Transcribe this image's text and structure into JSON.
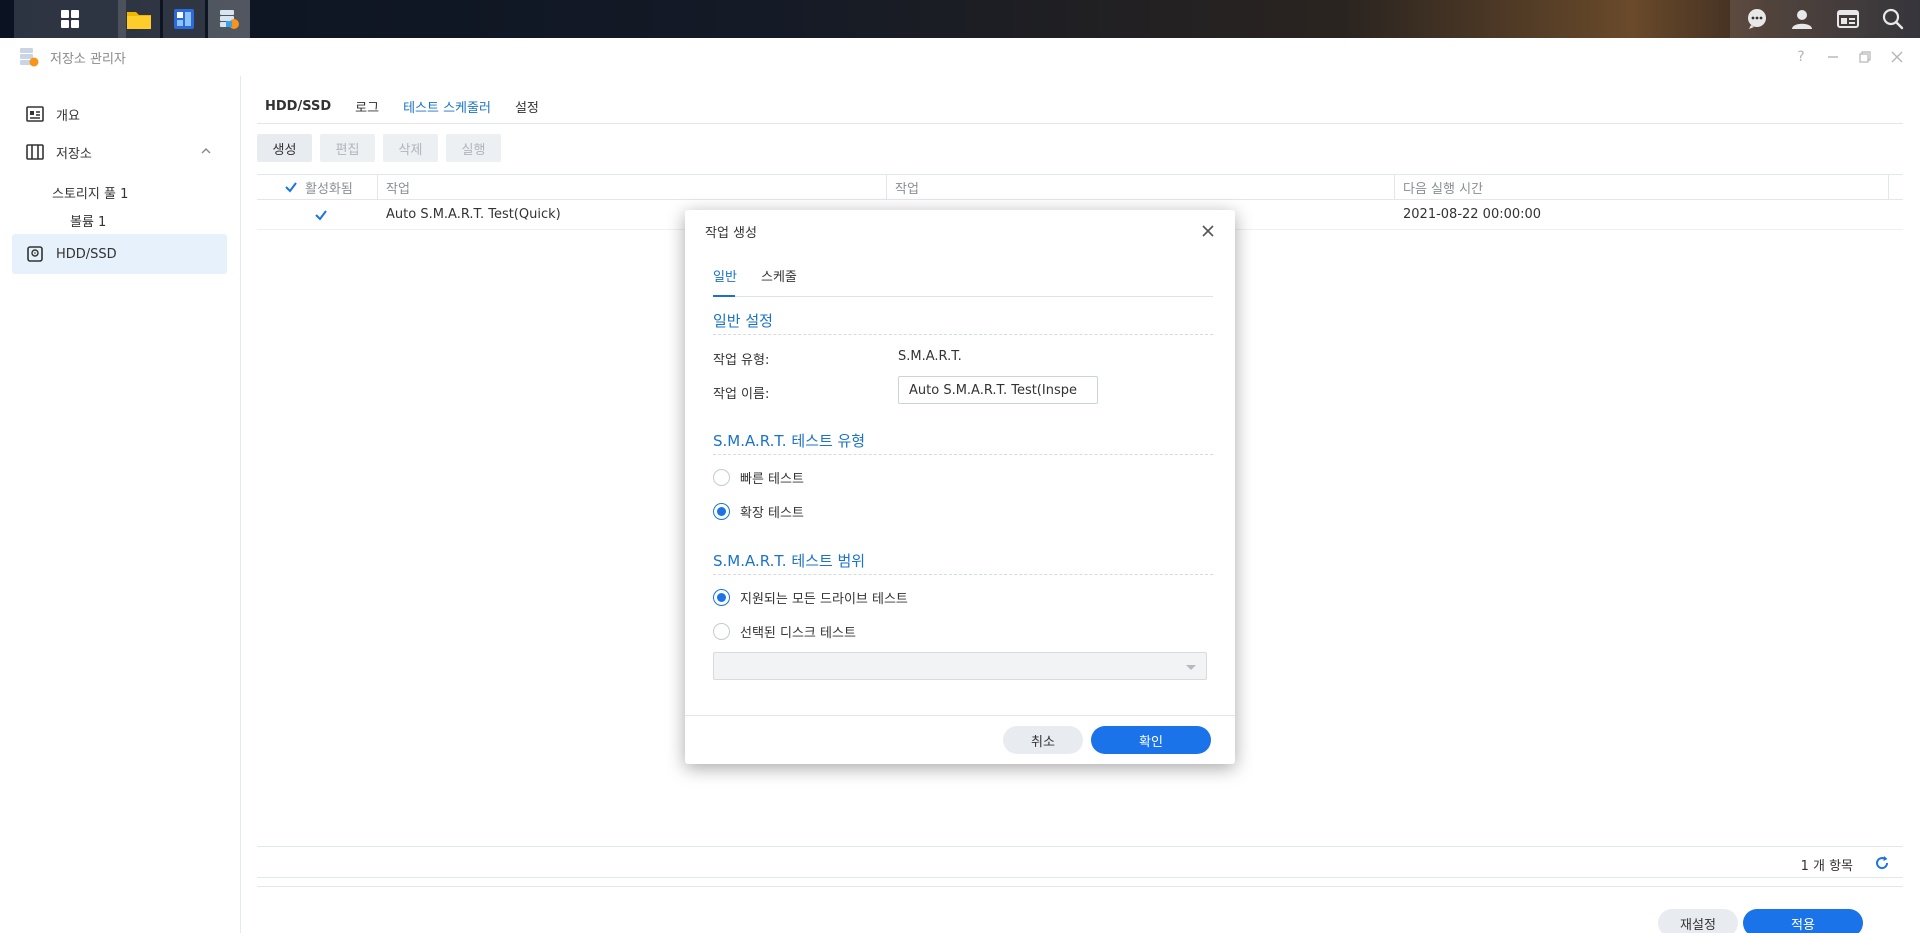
{
  "taskbar": {
    "apps_icon": "apps-grid-icon",
    "pinned": [
      {
        "name": "file-station-icon",
        "color": "#f5b400"
      },
      {
        "name": "package-center-icon",
        "color": "#2b6ad8"
      },
      {
        "name": "storage-manager-icon",
        "color": "#6a8bb5"
      }
    ],
    "right_icons": [
      "chat-icon",
      "user-icon",
      "widgets-icon",
      "search-icon"
    ]
  },
  "window": {
    "title": "저장소 관리자"
  },
  "sidebar": {
    "items": [
      {
        "label": "개요",
        "icon": "overview-icon"
      },
      {
        "label": "저장소",
        "icon": "storage-icon"
      },
      {
        "label": "HDD/SSD",
        "icon": "hdd-icon"
      }
    ],
    "sub_items": [
      {
        "label": "스토리지 풀 1"
      },
      {
        "label": "볼륨 1"
      }
    ]
  },
  "main": {
    "tabs": [
      {
        "label": "HDD/SSD"
      },
      {
        "label": "로그"
      },
      {
        "label": "테스트 스케줄러"
      },
      {
        "label": "설정"
      }
    ],
    "toolbar": {
      "create": "생성",
      "edit": "편집",
      "delete": "삭제",
      "run": "실행"
    },
    "grid": {
      "columns": [
        "활성화됨",
        "작업",
        "작업",
        "다음 실행 시간"
      ],
      "rows": [
        {
          "enabled": true,
          "task": "Auto S.M.A.R.T. Test(Quick)",
          "task2": "",
          "next_run": "2021-08-22 00:00:00"
        }
      ],
      "count_label": "1 개 항목"
    },
    "footer": {
      "reset": "재설정",
      "apply": "적용"
    }
  },
  "dialog": {
    "title": "작업 생성",
    "tabs": [
      {
        "label": "일반"
      },
      {
        "label": "스케줄"
      }
    ],
    "general_section": "일반 설정",
    "task_type_label": "작업 유형:",
    "task_type_value": "S.M.A.R.T.",
    "task_name_label": "작업 이름:",
    "task_name_value": "Auto S.M.A.R.T. Test(Inspe",
    "test_type_section": "S.M.A.R.T. 테스트 유형",
    "test_type_options": [
      {
        "label": "빠른 테스트",
        "selected": false
      },
      {
        "label": "확장 테스트",
        "selected": true
      }
    ],
    "test_scope_section": "S.M.A.R.T. 테스트 범위",
    "test_scope_options": [
      {
        "label": "지원되는 모든 드라이브 테스트",
        "selected": true
      },
      {
        "label": "선택된 디스크 테스트",
        "selected": false
      }
    ],
    "disk_select_value": "",
    "cancel": "취소",
    "ok": "확인"
  },
  "colors": {
    "accent": "#1a73e8",
    "active_bg": "#e7f1fb"
  }
}
